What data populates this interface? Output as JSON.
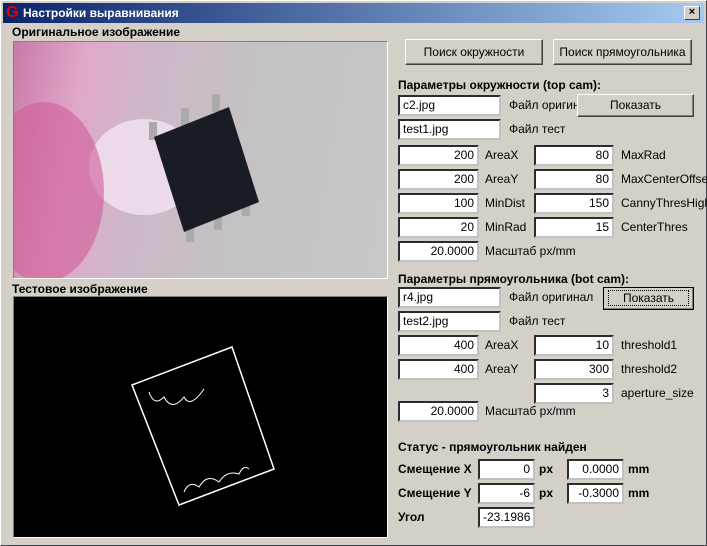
{
  "window": {
    "title": "Настройки выравнивания",
    "app_icon": "G",
    "close": "×"
  },
  "images": {
    "original_label": "Оригинальное изображение",
    "test_label": "Тестовое изображение"
  },
  "buttons": {
    "find_circle": "Поиск окружности",
    "find_rect": "Поиск прямоугольника"
  },
  "circle": {
    "header": "Параметры окружности (top cam):",
    "file_original": "c2.jpg",
    "file_original_label": "Файл оригинал",
    "show": "Показать",
    "file_test": "test1.jpg",
    "file_test_label": "Файл тест",
    "left": [
      {
        "value": "200",
        "label": "AreaX"
      },
      {
        "value": "200",
        "label": "AreaY"
      },
      {
        "value": "100",
        "label": "MinDist"
      },
      {
        "value": "20",
        "label": "MinRad"
      }
    ],
    "right": [
      {
        "value": "80",
        "label": "MaxRad"
      },
      {
        "value": "80",
        "label": "MaxCenterOffset"
      },
      {
        "value": "150",
        "label": "CannyThresHigh"
      },
      {
        "value": "15",
        "label": "CenterThres"
      }
    ],
    "scale": "20.0000",
    "scale_label": "Масштаб px/mm"
  },
  "rect": {
    "header": "Параметры прямоугольника (bot cam):",
    "file_original": "r4.jpg",
    "file_original_label": "Файл оригинал",
    "show": "Показать",
    "file_test": "test2.jpg",
    "file_test_label": "Файл тест",
    "left": [
      {
        "value": "400",
        "label": "AreaX"
      },
      {
        "value": "400",
        "label": "AreaY"
      }
    ],
    "right": [
      {
        "value": "10",
        "label": "threshold1"
      },
      {
        "value": "300",
        "label": "threshold2"
      },
      {
        "value": "3",
        "label": "aperture_size"
      }
    ],
    "scale": "20.0000",
    "scale_label": "Масштаб px/mm"
  },
  "status": {
    "text": "Статус - прямоугольник найден",
    "offset_x_label": "Смещение X",
    "offset_x_px": "0",
    "offset_x_mm": "0.0000",
    "offset_y_label": "Смещение Y",
    "offset_y_px": "-6",
    "offset_y_mm": "-0.3000",
    "px": "px",
    "mm": "mm",
    "angle_label": "Угол",
    "angle": "-23.1986"
  }
}
